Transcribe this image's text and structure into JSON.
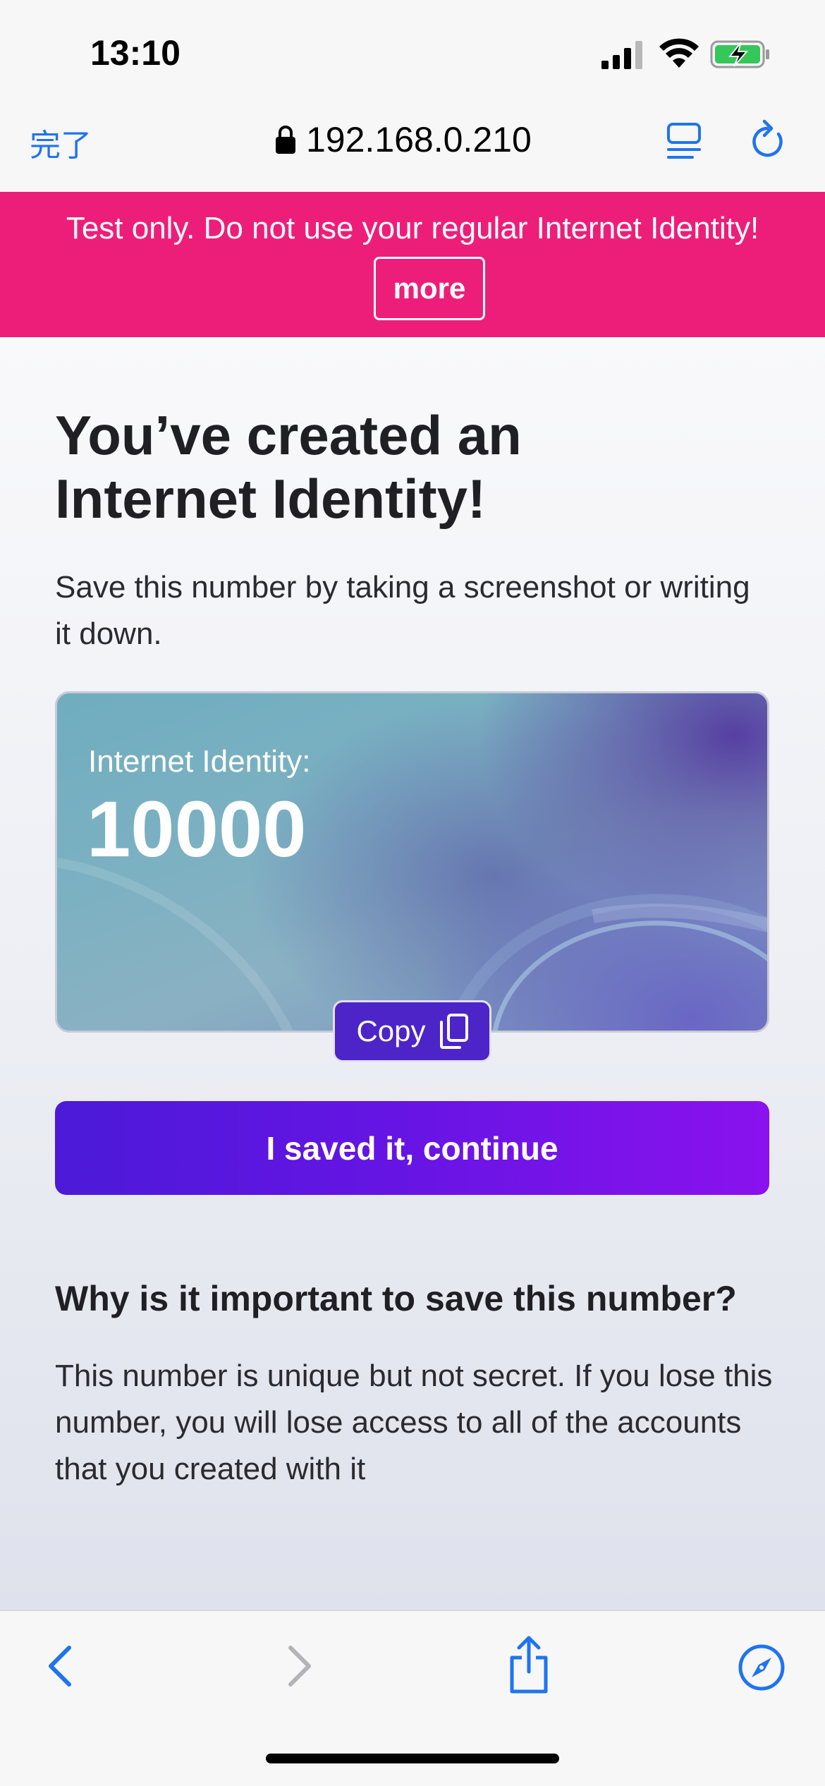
{
  "status_bar": {
    "time": "13:10",
    "icons": [
      "cellular-signal-icon",
      "wifi-icon",
      "battery-charging-icon"
    ]
  },
  "browser": {
    "done_label": "完了",
    "url": "192.168.0.210",
    "icons": [
      "lock-icon",
      "reader-mode-icon",
      "reload-icon"
    ],
    "accent_color": "#1f74f0"
  },
  "banner": {
    "text": "Test only. Do not use your regular Internet Identity!",
    "more_label": "more",
    "color": "#ed1e79"
  },
  "main": {
    "title_line1": "You’ve created an",
    "title_line2": "Internet Identity!",
    "subtitle": "Save this number by taking a screenshot or writing it down.",
    "card": {
      "label": "Internet Identity:",
      "number": "10000"
    },
    "copy_label": "Copy",
    "continue_label": "I saved it, continue",
    "why_heading": "Why is it important to save this number?",
    "why_body": "This number is unique but not secret. If you lose this number, you will lose access to all of the accounts that you created with it"
  },
  "toolbar": {
    "icons": [
      "back-icon",
      "forward-icon",
      "share-icon",
      "safari-compass-icon"
    ]
  }
}
